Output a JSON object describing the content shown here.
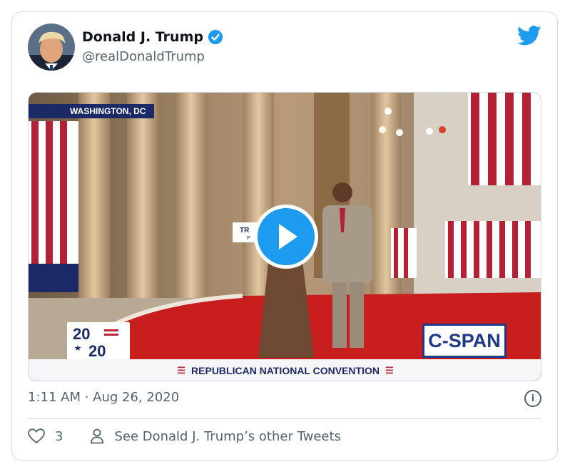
{
  "tweet": {
    "display_name": "Donald J. Trump",
    "handle": "@realDonaldTrump",
    "timestamp": "1:11 AM · Aug 26, 2020",
    "likes": "3",
    "other_tweets_link": "See Donald J. Trump’s other Tweets"
  },
  "media": {
    "location_tag": "WASHINGTON, DC",
    "logo_top": "20",
    "logo_bottom": "20",
    "network": "C-SPAN",
    "banner": "REPUBLICAN NATIONAL CONVENTION",
    "podium_sign_top": "TR",
    "podium_sign_bottom": "P"
  },
  "colors": {
    "accent": "#1d9bf0",
    "text_secondary": "#536471",
    "border": "#cfd9de"
  },
  "icons": [
    "verified-badge-icon",
    "twitter-bird-icon",
    "play-icon",
    "info-icon",
    "heart-icon",
    "person-icon"
  ]
}
